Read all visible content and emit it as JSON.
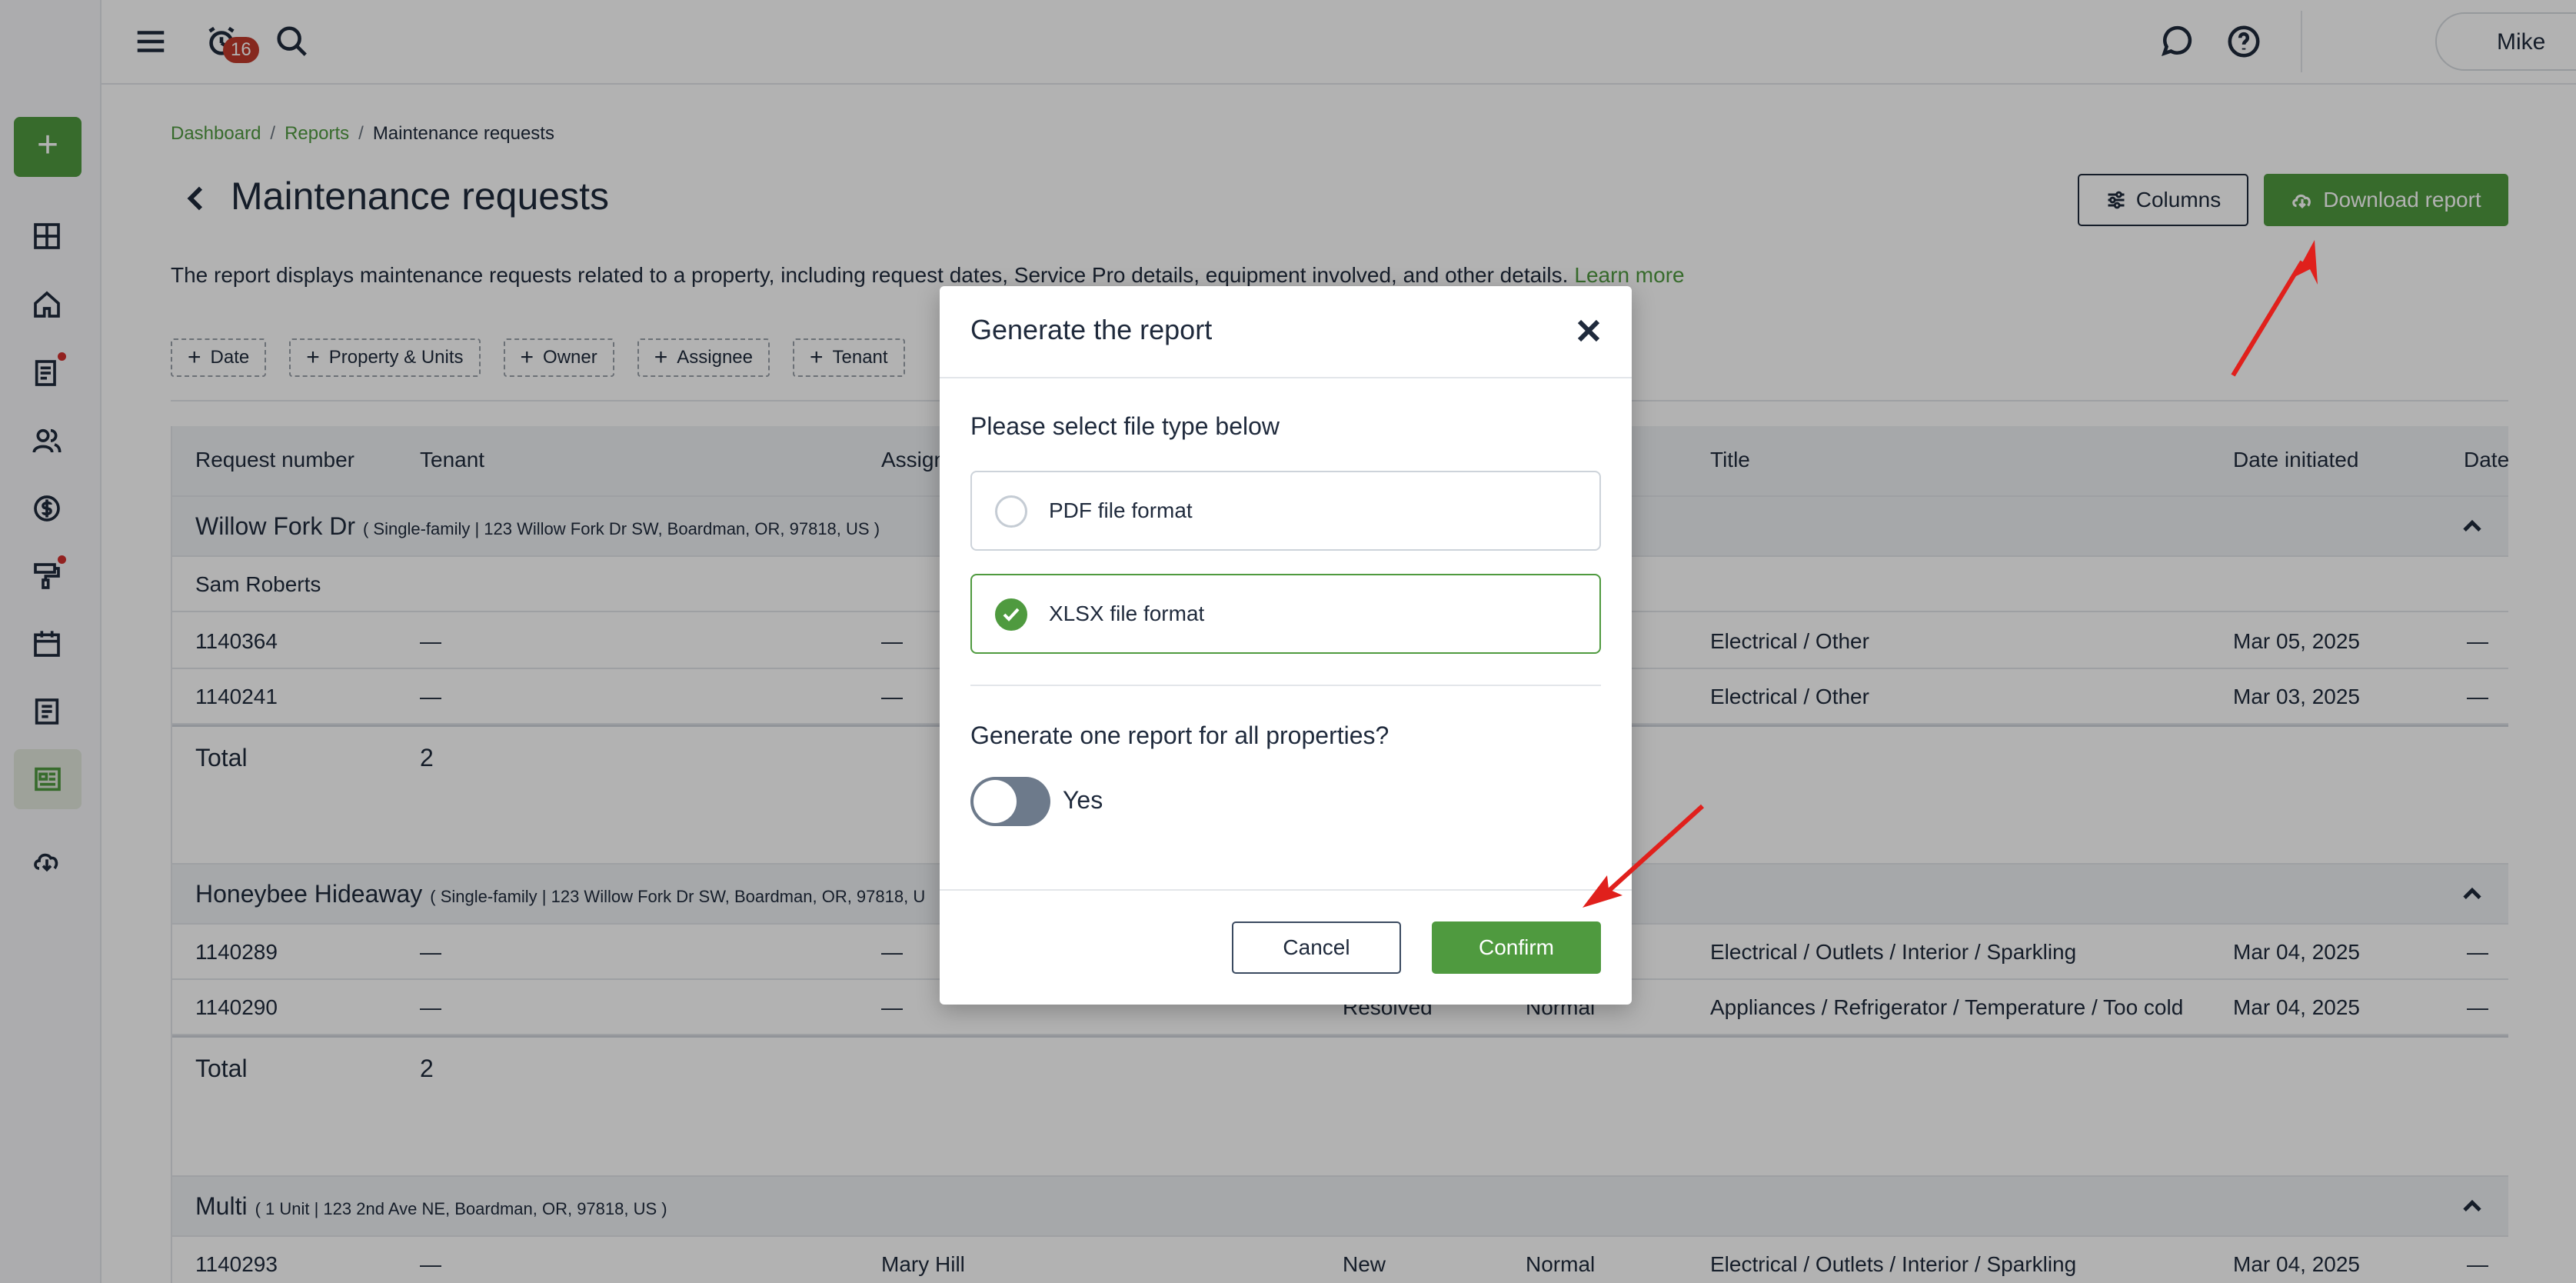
{
  "colors": {
    "accent": "#4f9a3f",
    "text": "#1f2a3c",
    "badge": "#c03a2b",
    "annotation": "#e0201c"
  },
  "sidebar": {
    "add_label": "+",
    "items": [
      {
        "icon": "dashboard-icon"
      },
      {
        "icon": "home-icon"
      },
      {
        "icon": "documents-icon"
      },
      {
        "icon": "people-icon"
      },
      {
        "icon": "dollar-icon"
      },
      {
        "icon": "paint-roller-icon"
      },
      {
        "icon": "calendar-icon"
      },
      {
        "icon": "notes-icon"
      },
      {
        "icon": "reports-icon"
      },
      {
        "icon": "download-cloud-icon"
      }
    ]
  },
  "topbar": {
    "notification_count": "16",
    "user_name": "Mike"
  },
  "breadcrumb": {
    "items": [
      "Dashboard",
      "Reports"
    ],
    "separator": "/",
    "current": "Maintenance requests"
  },
  "page": {
    "title": "Maintenance requests",
    "columns_button": "Columns",
    "download_button": "Download report",
    "description": "The report displays maintenance requests related to a property, including request dates, Service Pro details, equipment involved, and other details.",
    "learn_more": "Learn more"
  },
  "filters": [
    "Date",
    "Property & Units",
    "Owner",
    "Assignee",
    "Tenant"
  ],
  "table": {
    "headers": [
      "Request number",
      "Tenant",
      "Assignee",
      "Title",
      "Date initiated",
      "Date"
    ],
    "groups": [
      {
        "name": "Willow Fork Dr",
        "address": "( Single-family | 123 Willow Fork Dr SW, Boardman, OR, 97818, US )",
        "owner": "Sam Roberts",
        "rows": [
          {
            "number": "1140364",
            "tenant": "—",
            "assignee": "—",
            "status": "",
            "priority": "",
            "title": "Electrical / Other",
            "date": "Mar 05, 2025",
            "last": "—"
          },
          {
            "number": "1140241",
            "tenant": "—",
            "assignee": "—",
            "status": "",
            "priority": "",
            "title": "Electrical / Other",
            "date": "Mar 03, 2025",
            "last": "—"
          }
        ],
        "total_label": "Total",
        "total_value": "2"
      },
      {
        "name": "Honeybee Hideaway",
        "address": "( Single-family | 123 Willow Fork Dr SW, Boardman, OR, 97818, U",
        "rows": [
          {
            "number": "1140289",
            "tenant": "—",
            "assignee": "—",
            "status": "",
            "priority": "",
            "title": "Electrical / Outlets / Interior / Sparkling",
            "date": "Mar 04, 2025",
            "last": "—"
          },
          {
            "number": "1140290",
            "tenant": "—",
            "assignee": "—",
            "status": "Resolved",
            "priority": "Normal",
            "title": "Appliances / Refrigerator / Temperature / Too cold",
            "date": "Mar 04, 2025",
            "last": "—"
          }
        ],
        "total_label": "Total",
        "total_value": "2"
      },
      {
        "name": "Multi",
        "address": "( 1 Unit | 123 2nd Ave NE, Boardman, OR, 97818, US )",
        "rows": [
          {
            "number": "1140293",
            "tenant": "—",
            "assignee": "Mary Hill",
            "status": "New",
            "priority": "Normal",
            "title": "Electrical / Outlets / Interior / Sparkling",
            "date": "Mar 04, 2025",
            "last": "—"
          }
        ]
      }
    ]
  },
  "modal": {
    "title": "Generate the report",
    "file_type_prompt": "Please select file type below",
    "options": [
      {
        "label": "PDF file format",
        "selected": false
      },
      {
        "label": "XLSX file format",
        "selected": true
      }
    ],
    "all_properties_prompt": "Generate one report for all properties?",
    "toggle_label": "Yes",
    "toggle_on": false,
    "cancel": "Cancel",
    "confirm": "Confirm"
  }
}
